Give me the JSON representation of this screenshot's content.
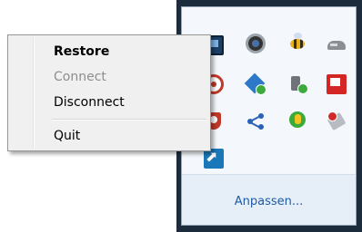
{
  "context_menu": {
    "items": [
      {
        "label": "Restore",
        "bold": true,
        "enabled": true
      },
      {
        "label": "Connect",
        "bold": false,
        "enabled": false
      },
      {
        "label": "Disconnect",
        "bold": false,
        "enabled": true
      },
      {
        "label": "Quit",
        "bold": false,
        "enabled": true
      }
    ]
  },
  "tray_overflow": {
    "customize_label": "Anpassen...",
    "icons": [
      "monitor-icon",
      "camera-icon",
      "bee-icon",
      "drive-icon",
      "red-round-icon",
      "dropbox-icon",
      "usb-icon",
      "note-icon",
      "shield-icon",
      "share-icon",
      "lightbulb-icon",
      "tools-icon",
      "arrow-icon"
    ]
  },
  "colors": {
    "window_frame": "#1d2c3c",
    "link": "#1f5aa6",
    "disabled_text": "#8d8d8d"
  }
}
